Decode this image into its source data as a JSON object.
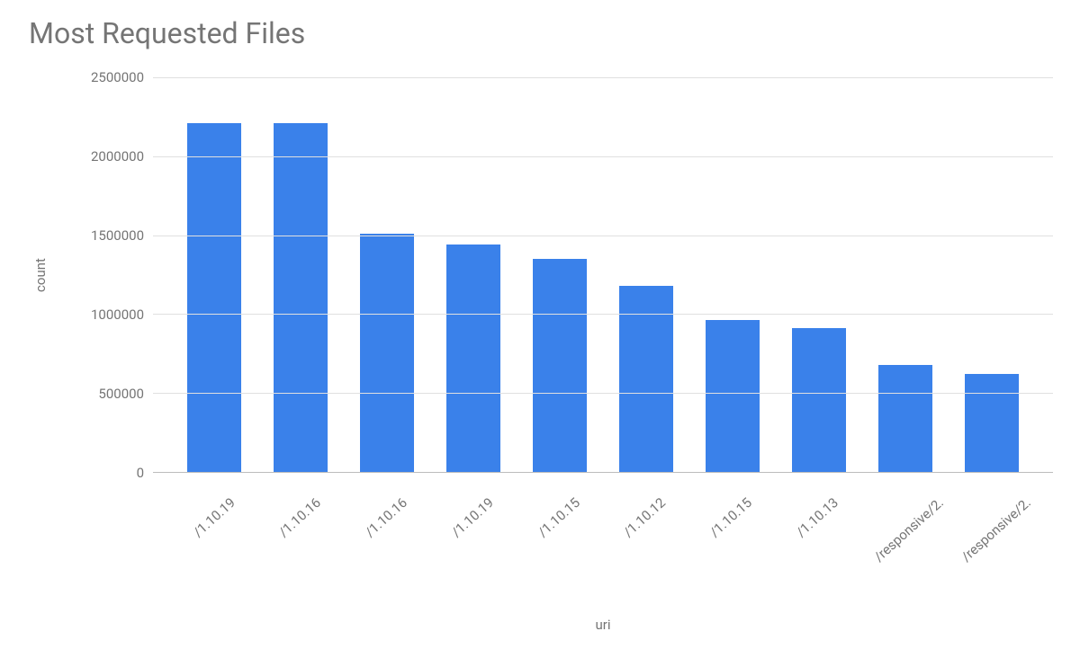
{
  "chart_data": {
    "type": "bar",
    "title": "Most Requested Files",
    "xlabel": "uri",
    "ylabel": "count",
    "ylim": [
      0,
      2500000
    ],
    "yticks": [
      0,
      500000,
      1000000,
      1500000,
      2000000,
      2500000
    ],
    "categories": [
      "/1.10.19",
      "/1.10.16",
      "/1.10.16",
      "/1.10.19",
      "/1.10.15",
      "/1.10.12",
      "/1.10.15",
      "/1.10.13",
      "/responsive/2.",
      "/responsive/2."
    ],
    "values": [
      2210000,
      2210000,
      1510000,
      1440000,
      1350000,
      1180000,
      960000,
      910000,
      680000,
      620000
    ]
  }
}
